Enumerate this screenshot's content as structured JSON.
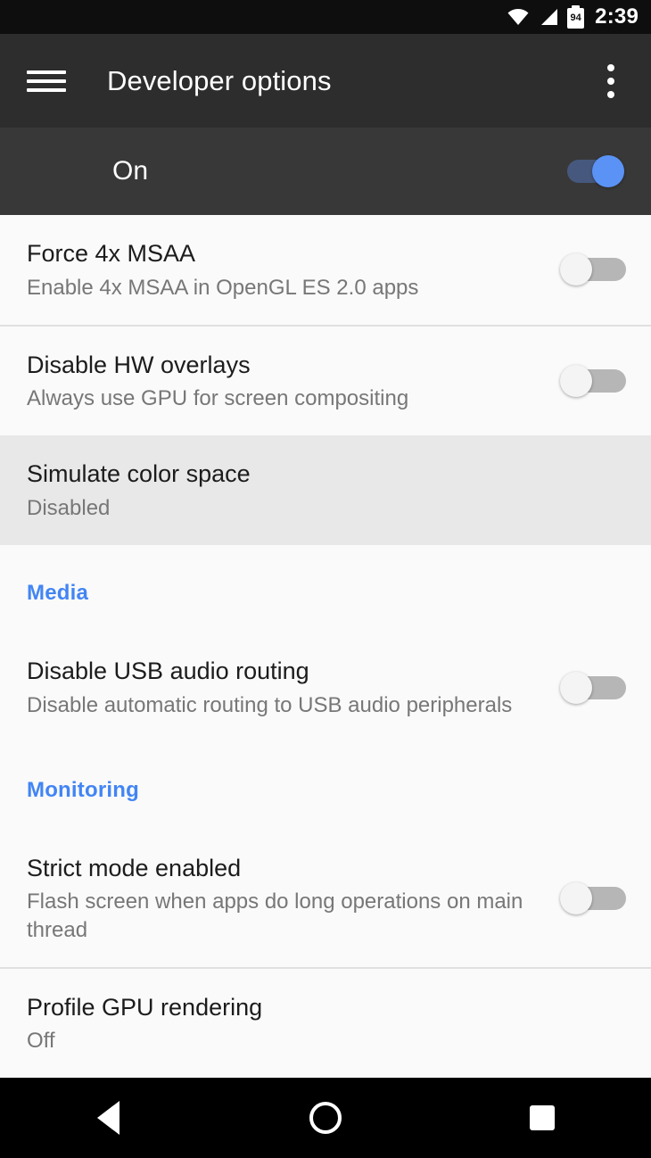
{
  "status_bar": {
    "time": "2:39",
    "battery_level": "94",
    "icons": [
      "wifi-icon",
      "cellular-signal-icon",
      "battery-icon"
    ]
  },
  "app_bar": {
    "title": "Developer options",
    "menu_icon": "hamburger-menu-icon",
    "overflow_icon": "overflow-menu-icon"
  },
  "master_switch": {
    "label": "On",
    "state": "on"
  },
  "colors": {
    "status_bar_bg": "#0e0e0e",
    "app_bar_bg": "#2d2d2d",
    "master_row_bg": "#383838",
    "list_bg": "#fafafa",
    "highlight_bg": "#e8e8e8",
    "accent": "#4285f4",
    "switch_on_thumb": "#5b92f5",
    "switch_on_track": "#46587d",
    "switch_off_thumb": "#f4f4f4",
    "switch_off_track": "#b6b6b6",
    "title_text": "#1c1c1c",
    "sub_text": "#777777",
    "divider": "#e0e0e0",
    "nav_bar_bg": "#000000"
  },
  "settings": [
    {
      "title": "Force 4x MSAA",
      "subtitle": "Enable 4x MSAA in OpenGL ES 2.0 apps",
      "control": "switch",
      "state": "off",
      "highlighted": false
    },
    {
      "title": "Disable HW overlays",
      "subtitle": "Always use GPU for screen compositing",
      "control": "switch",
      "state": "off",
      "highlighted": false
    },
    {
      "title": "Simulate color space",
      "subtitle": "Disabled",
      "control": "none",
      "state": "",
      "highlighted": true
    }
  ],
  "sections": [
    {
      "header": "Media",
      "items": [
        {
          "title": "Disable USB audio routing",
          "subtitle": "Disable automatic routing to USB audio peripherals",
          "control": "switch",
          "state": "off"
        }
      ]
    },
    {
      "header": "Monitoring",
      "items": [
        {
          "title": "Strict mode enabled",
          "subtitle": "Flash screen when apps do long operations on main thread",
          "control": "switch",
          "state": "off"
        }
      ]
    }
  ],
  "partial_item": {
    "title": "Profile GPU rendering",
    "subtitle": "Off",
    "control": "none"
  },
  "nav_bar": {
    "back_label": "Back",
    "home_label": "Home",
    "recents_label": "Recents"
  }
}
